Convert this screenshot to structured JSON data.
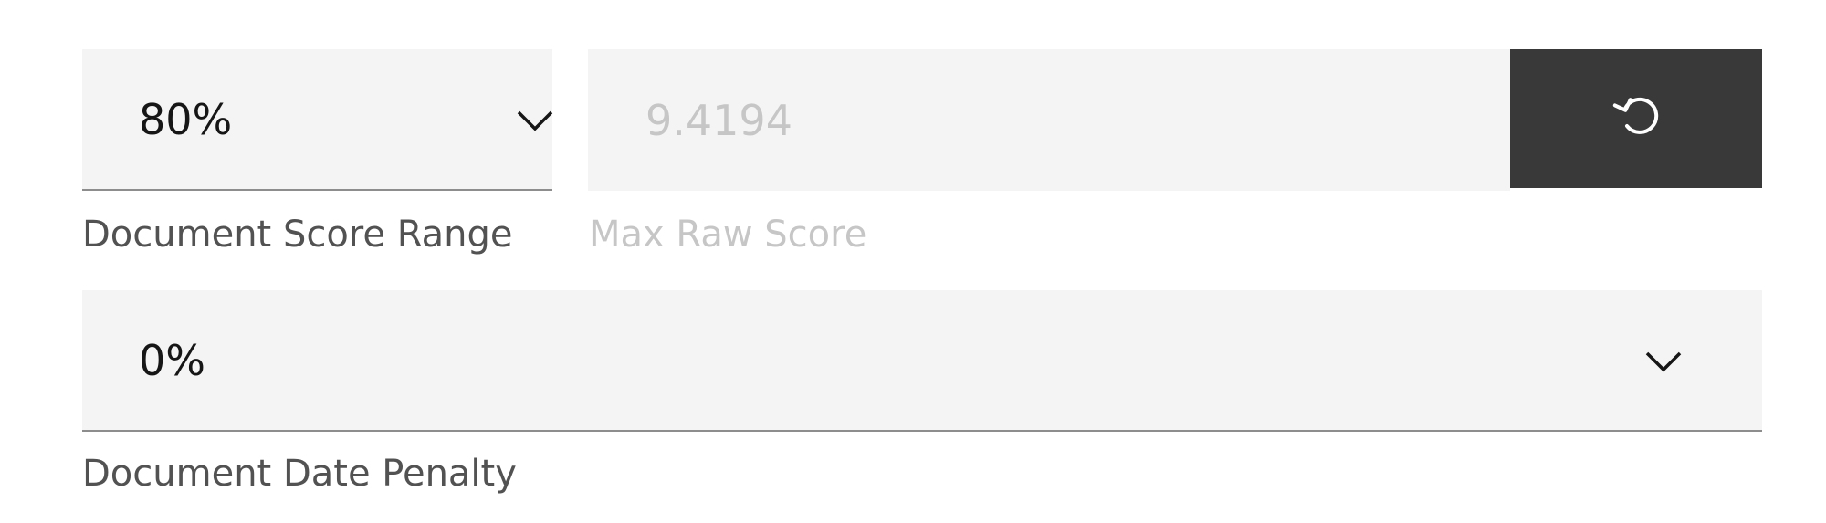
{
  "score_range": {
    "selected": "80%",
    "label": "Document Score Range"
  },
  "max_raw_score": {
    "value": "9.4194",
    "label": "Max Raw Score"
  },
  "date_penalty": {
    "selected": "0%",
    "label": "Document Date Penalty"
  },
  "colors": {
    "field_bg": "#f4f4f4",
    "button_bg": "#393939",
    "text": "#161616",
    "label": "#525252",
    "disabled": "#c6c6c6"
  }
}
